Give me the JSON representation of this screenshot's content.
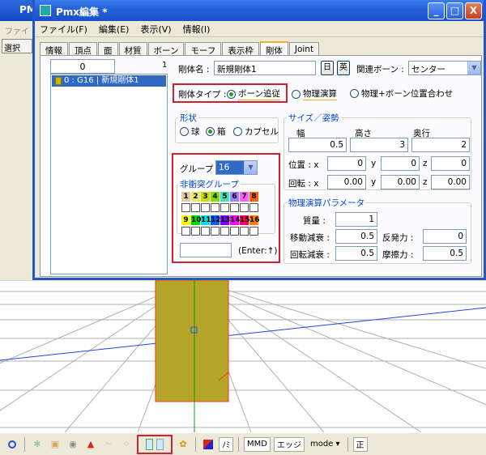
{
  "app": {
    "main_title": "PM",
    "side_menu_label": "ファイ",
    "side_select_label": "選択"
  },
  "dialog": {
    "title": "Pmx編集 *",
    "buttons": {
      "minimize": "_",
      "maximize": "□",
      "close": "X"
    },
    "menu": [
      "ファイル(F)",
      "編集(E)",
      "表示(V)",
      "情報(I)"
    ],
    "tabs": [
      "情報",
      "頂点",
      "面",
      "材質",
      "ボーン",
      "モーフ",
      "表示枠",
      "剛体",
      "Joint"
    ],
    "active_tab": "剛体"
  },
  "list": {
    "index_value": "0",
    "count": "1",
    "items": [
      "0 : G16 | 新規剛体1"
    ]
  },
  "body": {
    "name_label": "剛体名 :",
    "name_value": "新規剛体1",
    "lang_jp": "日",
    "lang_en": "英",
    "bone_label": "関連ボーン :",
    "bone_value": "センター",
    "type_label": "剛体タイプ :",
    "type_options": [
      "ボーン追従",
      "物理演算",
      "物理+ボーン位置合わせ"
    ],
    "type_selected": "ボーン追従"
  },
  "shape": {
    "title": "形状",
    "options": [
      "球",
      "箱",
      "カプセル"
    ],
    "selected": "箱"
  },
  "group": {
    "label": "グループ :",
    "value": "16",
    "no_collision_title": "非衝突グループ",
    "row1_numbers": [
      "1",
      "2",
      "3",
      "4",
      "5",
      "6",
      "7",
      "8"
    ],
    "row2_numbers": [
      "9",
      "10",
      "11",
      "12",
      "13",
      "14",
      "15",
      "16"
    ],
    "row1_colors": [
      "#e0c8a0",
      "#e8e860",
      "#c8e000",
      "#80e000",
      "#40e0c0",
      "#a080ff",
      "#ff60ff",
      "#ff6000"
    ],
    "row2_colors": [
      "#ffff00",
      "#00e000",
      "#00e0e0",
      "#0060ff",
      "#8000ff",
      "#ff00ff",
      "#ff0060",
      "#ff8000"
    ],
    "enter_input": "",
    "enter_label": "(Enter:↑)"
  },
  "size": {
    "title": "サイズ／姿勢",
    "width_label": "幅",
    "height_label": "高さ",
    "depth_label": "奥行",
    "width": "0.5",
    "height": "3",
    "depth": "2",
    "pos_label": "位置 : x",
    "pos_x": "0",
    "pos_y": "0",
    "pos_z": "0",
    "rot_label": "回転 : x",
    "rot_x": "0.00",
    "rot_y": "0.00",
    "rot_z": "0.00",
    "y_label": "y",
    "z_label": "z"
  },
  "physics": {
    "title": "物理演算パラメータ",
    "mass_label": "質量 :",
    "mass": "1",
    "move_damp_label": "移動減衰 :",
    "move_damp": "0.5",
    "repulsion_label": "反発力 :",
    "repulsion": "0",
    "rot_damp_label": "回転減衰 :",
    "rot_damp": "0.5",
    "friction_label": "摩擦力 :",
    "friction": "0.5"
  },
  "toolbar": {
    "nomi_label": "ﾉﾐ",
    "md_label": "MMD",
    "edge_label": "エッジ",
    "mode_label": "mode ▾",
    "sei_label": "正"
  },
  "colors": {
    "highlight_red": "#d0222e",
    "selection_blue": "#316ac5",
    "box_fill": "#b5a62a"
  }
}
